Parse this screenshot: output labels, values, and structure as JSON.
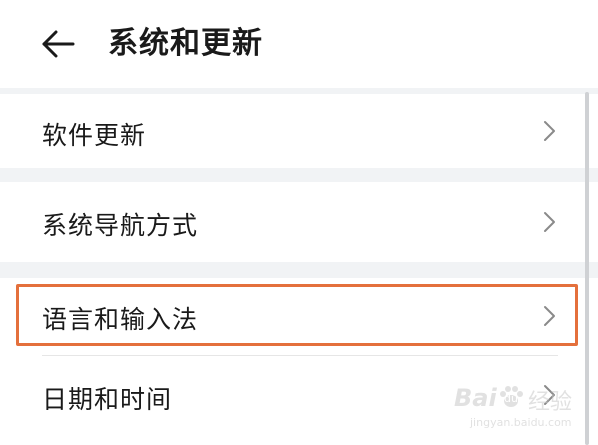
{
  "header": {
    "back_icon": "arrow-left-icon",
    "title": "系统和更新"
  },
  "rows": [
    {
      "label": "软件更新",
      "icon": "chevron-right-icon"
    },
    {
      "label": "系统导航方式",
      "icon": "chevron-right-icon"
    },
    {
      "label": "语言和输入法",
      "icon": "chevron-right-icon",
      "highlighted": true
    },
    {
      "label": "日期和时间",
      "icon": "chevron-right-icon"
    }
  ],
  "highlight_color": "#e4703c",
  "watermark": {
    "brand": "Bai",
    "paw": "du",
    "text": "经验",
    "url": "jingyan.baidu.com"
  }
}
